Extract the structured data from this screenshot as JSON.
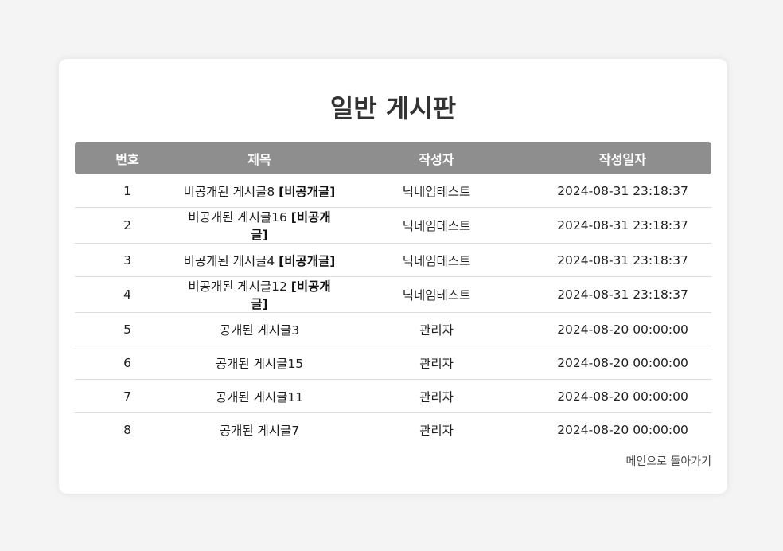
{
  "page": {
    "title": "일반 게시판",
    "back_link": "메인으로 돌아가기"
  },
  "table": {
    "headers": [
      "번호",
      "제목",
      "작성자",
      "작성일자"
    ],
    "rows": [
      {
        "no": "1",
        "title": "비공개된 게시글8",
        "tag": "[비공개글]",
        "author": "닉네임테스트",
        "date": "2024-08-31 23:18:37"
      },
      {
        "no": "2",
        "title": "비공개된 게시글16",
        "tag": "[비공개글]",
        "author": "닉네임테스트",
        "date": "2024-08-31 23:18:37"
      },
      {
        "no": "3",
        "title": "비공개된 게시글4",
        "tag": "[비공개글]",
        "author": "닉네임테스트",
        "date": "2024-08-31 23:18:37"
      },
      {
        "no": "4",
        "title": "비공개된 게시글12",
        "tag": "[비공개글]",
        "author": "닉네임테스트",
        "date": "2024-08-31 23:18:37"
      },
      {
        "no": "5",
        "title": "공개된 게시글3",
        "tag": "",
        "author": "관리자",
        "date": "2024-08-20 00:00:00"
      },
      {
        "no": "6",
        "title": "공개된 게시글15",
        "tag": "",
        "author": "관리자",
        "date": "2024-08-20 00:00:00"
      },
      {
        "no": "7",
        "title": "공개된 게시글11",
        "tag": "",
        "author": "관리자",
        "date": "2024-08-20 00:00:00"
      },
      {
        "no": "8",
        "title": "공개된 게시글7",
        "tag": "",
        "author": "관리자",
        "date": "2024-08-20 00:00:00"
      }
    ]
  },
  "colors": {
    "header_bg": "#8e8e8e",
    "page_bg": "#f4f4f4",
    "card_bg": "#ffffff"
  }
}
